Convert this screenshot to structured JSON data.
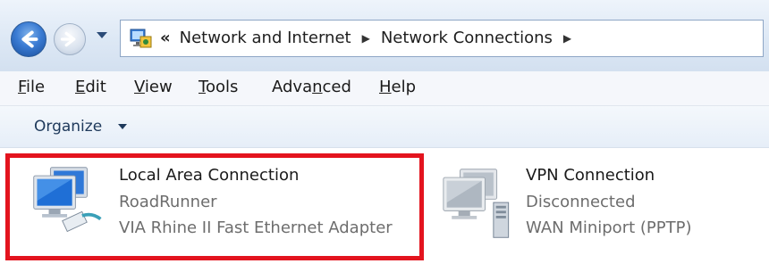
{
  "address_bar": {
    "overflow": "«",
    "crumbs": [
      "Network and Internet",
      "Network Connections"
    ]
  },
  "menu": [
    {
      "label": "File",
      "key": "F",
      "rest": "ile"
    },
    {
      "label": "Edit",
      "key": "E",
      "rest": "dit"
    },
    {
      "label": "View",
      "key": "V",
      "rest": "iew"
    },
    {
      "label": "Tools",
      "key": "T",
      "rest": "ools"
    },
    {
      "label": "Advanced",
      "pre": "Adva",
      "key": "n",
      "rest": "ced"
    },
    {
      "label": "Help",
      "key": "H",
      "rest": "elp"
    }
  ],
  "toolbar": {
    "organize": "Organize"
  },
  "connections": [
    {
      "name": "Local Area Connection",
      "status": "RoadRunner",
      "device": "VIA Rhine II Fast Ethernet Adapter",
      "icon": "ethernet-connection-icon",
      "highlighted": true
    },
    {
      "name": "VPN Connection",
      "status": "Disconnected",
      "device": "WAN Miniport (PPTP)",
      "icon": "vpn-connection-icon",
      "highlighted": false
    }
  ],
  "colors": {
    "highlight": "#e3141e",
    "secondary_text": "#6d6d6d"
  }
}
